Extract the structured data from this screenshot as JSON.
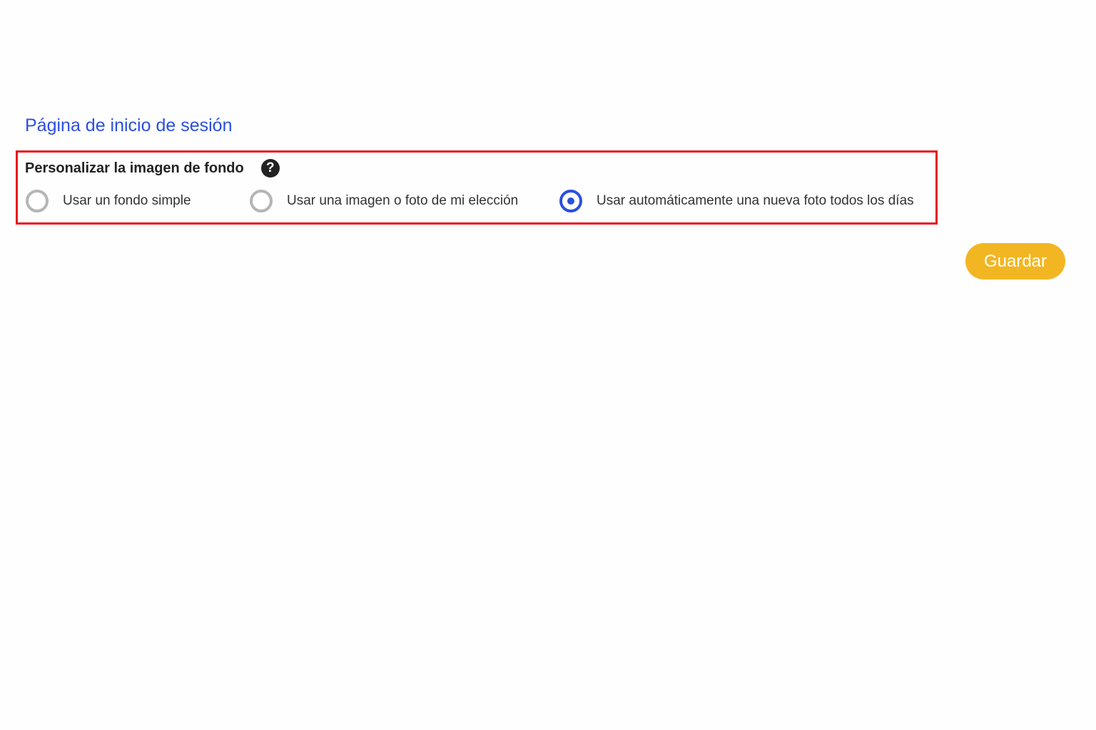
{
  "section": {
    "title": "Página de inicio de sesión"
  },
  "setting": {
    "label": "Personalizar la imagen de fondo",
    "help_icon": "question-circle-icon",
    "help_glyph": "?",
    "selected_index": 2,
    "options": [
      {
        "label": "Usar un fondo simple",
        "checked": false
      },
      {
        "label": "Usar una imagen o foto de mi elección",
        "checked": false
      },
      {
        "label": "Usar automáticamente una nueva foto todos los días",
        "checked": true
      }
    ]
  },
  "actions": {
    "save_label": "Guardar"
  },
  "colors": {
    "accent": "#2b4fe0",
    "highlight_border": "#e8141c",
    "save_button": "#f3b623",
    "radio_unchecked": "#b5b5b5"
  }
}
